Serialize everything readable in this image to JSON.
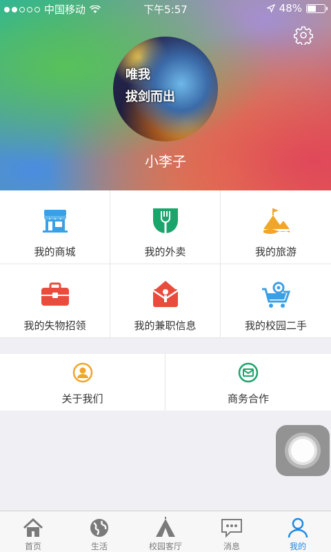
{
  "status_bar": {
    "carrier": "中国移动",
    "time": "下午5:57",
    "battery": "48%",
    "battery_level": 0.48
  },
  "profile": {
    "username": "小李子",
    "avatar_text_line1": "唯我",
    "avatar_text_line2": "拔剑而出"
  },
  "grid_items": [
    {
      "label": "我的商城",
      "icon": "store-icon",
      "color": "#3aa0e6"
    },
    {
      "label": "我的外卖",
      "icon": "fork-icon",
      "color": "#1aa56b"
    },
    {
      "label": "我的旅游",
      "icon": "travel-icon",
      "color": "#f0a62a"
    },
    {
      "label": "我的失物招领",
      "icon": "toolbox-icon",
      "color": "#e94b3c"
    },
    {
      "label": "我的兼职信息",
      "icon": "job-icon",
      "color": "#e94b3c"
    },
    {
      "label": "我的校园二手",
      "icon": "cart-icon",
      "color": "#3aa0e6"
    }
  ],
  "section2": [
    {
      "label": "关于我们",
      "icon": "person-circle-icon",
      "color": "#f0a62a"
    },
    {
      "label": "商务合作",
      "icon": "handshake-circle-icon",
      "color": "#1aa56b"
    }
  ],
  "tabs": [
    {
      "label": "首页",
      "icon": "home-icon"
    },
    {
      "label": "生活",
      "icon": "globe-icon"
    },
    {
      "label": "校园客厅",
      "icon": "tent-icon"
    },
    {
      "label": "消息",
      "icon": "message-icon"
    },
    {
      "label": "我的",
      "icon": "user-icon",
      "active": true
    }
  ],
  "colors": {
    "active_tab": "#1e88e5",
    "inactive_tab": "#7a7a7a"
  }
}
